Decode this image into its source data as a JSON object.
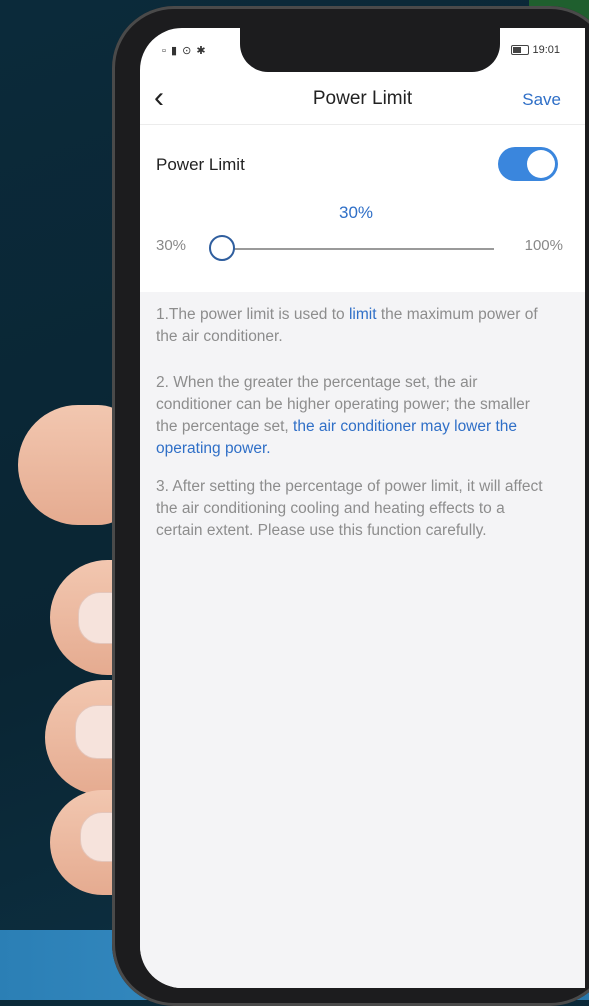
{
  "statusbar": {
    "left_icons": "▫ ▮ ⊙ ✱",
    "time": "19:01"
  },
  "header": {
    "back_icon": "‹",
    "title": "Power Limit",
    "save_label": "Save"
  },
  "power_limit": {
    "label": "Power Limit",
    "enabled": true,
    "value_label": "30%",
    "value_fraction": 0.0,
    "min_label": "30%",
    "max_label": "100%"
  },
  "notes": {
    "n1_a": "1.The power limit is used to ",
    "n1_hl": "limit",
    "n1_b": " the maximum power of the air conditioner.",
    "n2_a": "2. When the greater the percentage set, the air conditioner can be higher operating power; the smaller the percentage set, ",
    "n2_hl": "the air conditioner may lower the operating power.",
    "n3": "3. After setting the percentage of power limit, it will affect the air conditioning cooling and heating effects to a certain extent. Please use this function carefully."
  },
  "colors": {
    "accent": "#2f6fc7",
    "toggle_on": "#3a86dd"
  }
}
